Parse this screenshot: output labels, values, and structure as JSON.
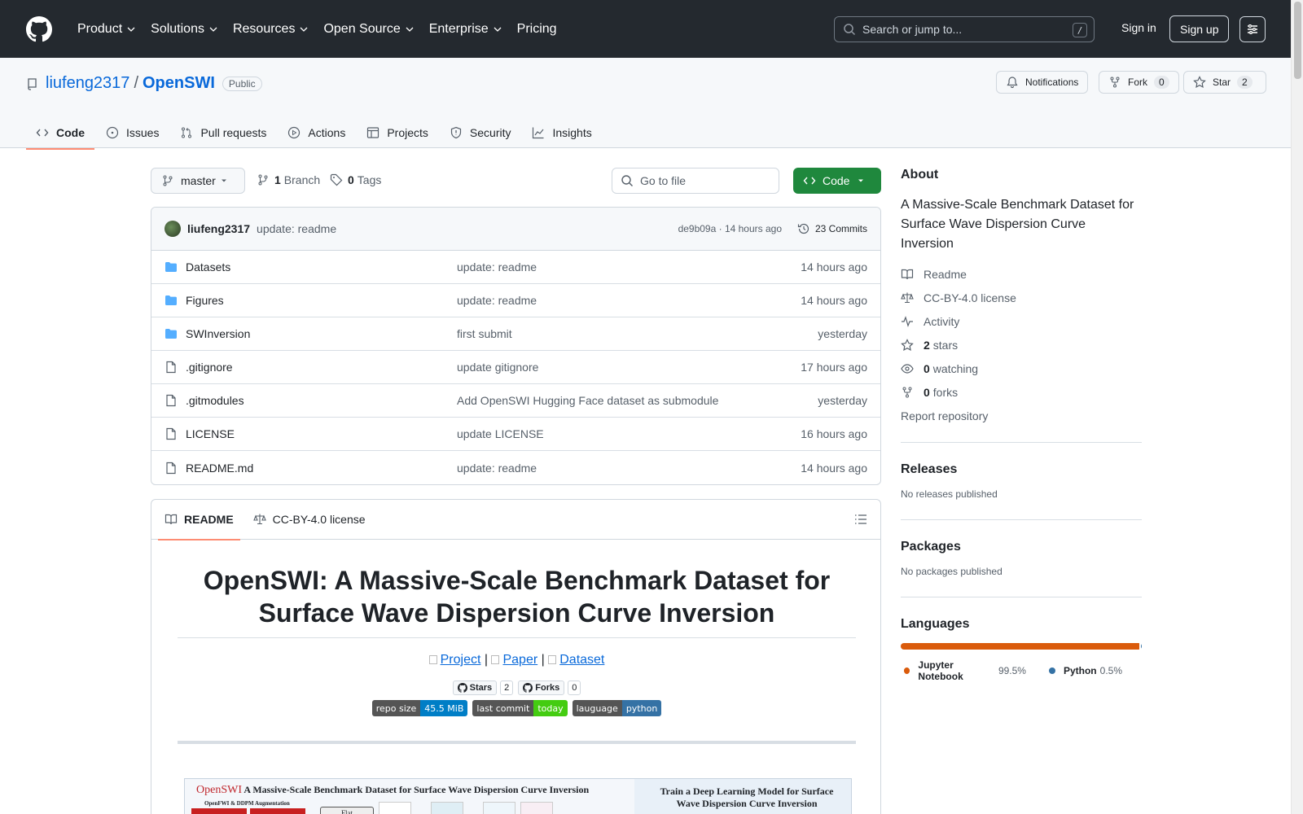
{
  "header": {
    "nav": [
      "Product",
      "Solutions",
      "Resources",
      "Open Source",
      "Enterprise",
      "Pricing"
    ],
    "search_placeholder": "Search or jump to...",
    "search_shortcut": "/",
    "signin": "Sign in",
    "signup": "Sign up"
  },
  "repo": {
    "owner": "liufeng2317",
    "sep": "/",
    "name": "OpenSWI",
    "visibility": "Public",
    "notifications_label": "Notifications",
    "fork_label": "Fork",
    "fork_count": "0",
    "star_label": "Star",
    "star_count": "2",
    "tabs": [
      "Code",
      "Issues",
      "Pull requests",
      "Actions",
      "Projects",
      "Security",
      "Insights"
    ]
  },
  "toolbar": {
    "branch": "master",
    "branch_count": "1",
    "branch_label": "Branch",
    "tag_count": "0",
    "tag_label": "Tags",
    "goto_placeholder": "Go to file",
    "code_button": "Code"
  },
  "commit": {
    "user": "liufeng2317",
    "message": "update: readme",
    "meta": "de9b09a · 14 hours ago",
    "commits": "23 Commits"
  },
  "files": [
    {
      "type": "folder",
      "name": "Datasets",
      "message": "update: readme",
      "time": "14 hours ago"
    },
    {
      "type": "folder",
      "name": "Figures",
      "message": "update: readme",
      "time": "14 hours ago"
    },
    {
      "type": "folder",
      "name": "SWInversion",
      "message": "first submit",
      "time": "yesterday"
    },
    {
      "type": "file",
      "name": ".gitignore",
      "message": "update gitignore",
      "time": "17 hours ago"
    },
    {
      "type": "file",
      "name": ".gitmodules",
      "message": "Add OpenSWI Hugging Face dataset as submodule",
      "time": "yesterday"
    },
    {
      "type": "file",
      "name": "LICENSE",
      "message": "update LICENSE",
      "time": "16 hours ago"
    },
    {
      "type": "file",
      "name": "README.md",
      "message": "update: readme",
      "time": "14 hours ago"
    }
  ],
  "readme": {
    "tab_readme": "README",
    "tab_license": "CC-BY-4.0 license",
    "title": "OpenSWI: A Massive-Scale Benchmark Dataset for Surface Wave Dispersion Curve Inversion",
    "link_project": "Project",
    "link_paper": "Paper",
    "link_dataset": "Dataset",
    "link_sep": "|",
    "badge_stars": "Stars",
    "badge_stars_count": "2",
    "badge_forks": "Forks",
    "badge_forks_count": "0",
    "shields": [
      {
        "key": "repo size",
        "value": "45.5 MiB",
        "color": "#007ec6"
      },
      {
        "key": "last commit",
        "value": "today",
        "color": "#44cc11"
      },
      {
        "key": "lauguage",
        "value": "python",
        "color": "#3572a5"
      }
    ],
    "figure": {
      "title_red": "OpenSWI",
      "title_rest": " A Massive-Scale Benchmark Dataset for Surface Wave Dispersion Curve Inversion",
      "subtitle": "OpenFWI & DDPM Augmentation",
      "box": "Flat",
      "right": "Train a Deep Learning Model for Surface Wave Dispersion Curve Inversion"
    }
  },
  "about": {
    "heading": "About",
    "description": "A Massive-Scale Benchmark Dataset for Surface Wave Dispersion Curve Inversion",
    "readme": "Readme",
    "license": "CC-BY-4.0 license",
    "activity": "Activity",
    "stars_count": "2",
    "stars_label": "stars",
    "watching_count": "0",
    "watching_label": "watching",
    "forks_count": "0",
    "forks_label": "forks",
    "report": "Report repository"
  },
  "releases": {
    "heading": "Releases",
    "text": "No releases published"
  },
  "packages": {
    "heading": "Packages",
    "text": "No packages published"
  },
  "languages": {
    "heading": "Languages",
    "items": [
      {
        "name": "Jupyter Notebook",
        "percent": "99.5%",
        "value": 99.5,
        "color": "#da5b0b"
      },
      {
        "name": "Python",
        "percent": "0.5%",
        "value": 0.5,
        "color": "#3572a5"
      }
    ]
  },
  "colors": {
    "accent": "#0969da",
    "green": "#1f883d",
    "header_bg": "#24292f",
    "tab_underline": "#fd8c73"
  }
}
